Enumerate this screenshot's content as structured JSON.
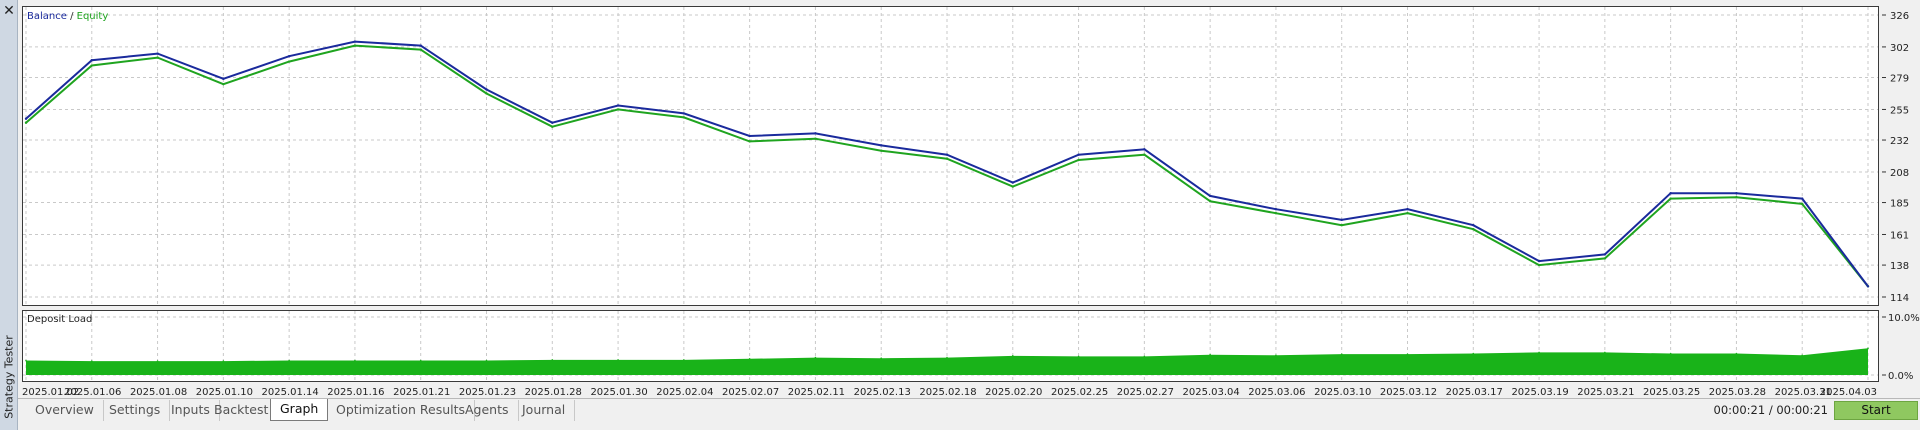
{
  "window": {
    "close_glyph": "✕",
    "side_title": "Strategy Tester"
  },
  "legend": {
    "balance": "Balance",
    "separator": " / ",
    "equity": "Equity"
  },
  "colors": {
    "balance": "#1a2a9c",
    "equity": "#1fa41f",
    "deposit_load": "#19b319",
    "grid": "#c9c9c9",
    "start_button": "#8fc860"
  },
  "deposit_load_title": "Deposit Load",
  "chart_data": [
    {
      "type": "line",
      "y_ticks": [
        326,
        302,
        279,
        255,
        232,
        208,
        185,
        161,
        138,
        114
      ],
      "ylim": [
        114,
        326
      ],
      "grid": true,
      "legend_position": "top-left",
      "x": [
        "2025.01.02",
        "2025.01.06",
        "2025.01.08",
        "2025.01.10",
        "2025.01.14",
        "2025.01.16",
        "2025.01.21",
        "2025.01.23",
        "2025.01.28",
        "2025.01.30",
        "2025.02.04",
        "2025.02.07",
        "2025.02.11",
        "2025.02.13",
        "2025.02.18",
        "2025.02.20",
        "2025.02.25",
        "2025.02.27",
        "2025.03.04",
        "2025.03.06",
        "2025.03.10",
        "2025.03.12",
        "2025.03.17",
        "2025.03.19",
        "2025.03.21",
        "2025.03.25",
        "2025.03.28",
        "2025.03.31",
        "2025.04.03"
      ],
      "series": [
        {
          "name": "Balance",
          "values": [
            248,
            292,
            297,
            278,
            295,
            306,
            303,
            270,
            245,
            258,
            252,
            235,
            237,
            228,
            221,
            200,
            221,
            225,
            190,
            180,
            172,
            180,
            168,
            141,
            146,
            192,
            192,
            188,
            122
          ]
        },
        {
          "name": "Equity",
          "values": [
            245,
            288,
            294,
            274,
            291,
            303,
            300,
            267,
            242,
            255,
            249,
            231,
            233,
            224,
            218,
            197,
            217,
            221,
            186,
            177,
            168,
            177,
            165,
            138,
            143,
            188,
            189,
            184,
            122
          ]
        }
      ]
    },
    {
      "type": "area",
      "title": "Deposit Load",
      "y_ticks": [
        "10.0%",
        "0.0%"
      ],
      "ylim": [
        0,
        10
      ],
      "x": [
        "2025.01.02",
        "2025.01.06",
        "2025.01.08",
        "2025.01.10",
        "2025.01.14",
        "2025.01.16",
        "2025.01.21",
        "2025.01.23",
        "2025.01.28",
        "2025.01.30",
        "2025.02.04",
        "2025.02.07",
        "2025.02.11",
        "2025.02.13",
        "2025.02.18",
        "2025.02.20",
        "2025.02.25",
        "2025.02.27",
        "2025.03.04",
        "2025.03.06",
        "2025.03.10",
        "2025.03.12",
        "2025.03.17",
        "2025.03.19",
        "2025.03.21",
        "2025.03.25",
        "2025.03.28",
        "2025.03.31",
        "2025.04.03"
      ],
      "values": [
        2.5,
        2.4,
        2.4,
        2.4,
        2.5,
        2.5,
        2.5,
        2.5,
        2.6,
        2.6,
        2.6,
        2.8,
        3.0,
        2.9,
        3.0,
        3.3,
        3.2,
        3.2,
        3.5,
        3.4,
        3.6,
        3.6,
        3.7,
        3.9,
        3.9,
        3.7,
        3.7,
        3.4,
        4.6
      ]
    }
  ],
  "tabs": [
    {
      "label": "Overview",
      "active": false
    },
    {
      "label": "Settings",
      "active": false
    },
    {
      "label": "Inputs",
      "active": false
    },
    {
      "label": "Backtest",
      "active": false
    },
    {
      "label": "Graph",
      "active": true
    },
    {
      "label": "Optimization Results",
      "active": false
    },
    {
      "label": "Agents",
      "active": false
    },
    {
      "label": "Journal",
      "active": false
    }
  ],
  "timer": "00:00:21 / 00:00:21",
  "start_label": "Start"
}
